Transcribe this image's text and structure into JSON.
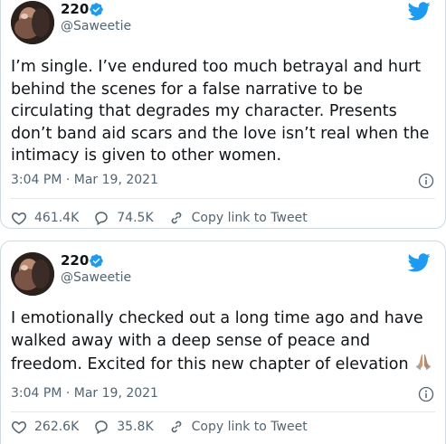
{
  "tweets": [
    {
      "name": "220",
      "handle": "@Saweetie",
      "text": "I’m single. I’ve endured too much betrayal and hurt behind the scenes for a false narrative to be circulating that degrades my character. Presents don’t band aid scars and the love isn’t real when the intimacy is given to other women.",
      "timestamp": "3:04 PM · Mar 19, 2021",
      "likes": "461.4K",
      "replies": "74.5K",
      "copy_link": "Copy link to Tweet"
    },
    {
      "name": "220",
      "handle": "@Saweetie",
      "text": "I emotionally checked out a long time ago and have walked away with a deep sense of peace and freedom. Excited for this new chapter of elevation",
      "emoji": "folded-hands",
      "timestamp": "3:04 PM · Mar 19, 2021",
      "likes": "262.6K",
      "replies": "35.8K",
      "copy_link": "Copy link to Tweet"
    }
  ],
  "icons": {
    "verified": "verified-badge-icon",
    "brand": "twitter-bird-icon",
    "info": "info-icon",
    "like": "heart-icon",
    "reply": "reply-bubble-icon",
    "link": "link-icon"
  },
  "colors": {
    "brand_blue": "#1d9bf0",
    "text_primary": "#0f1419",
    "text_secondary": "#536471",
    "border": "#cfd9de"
  }
}
